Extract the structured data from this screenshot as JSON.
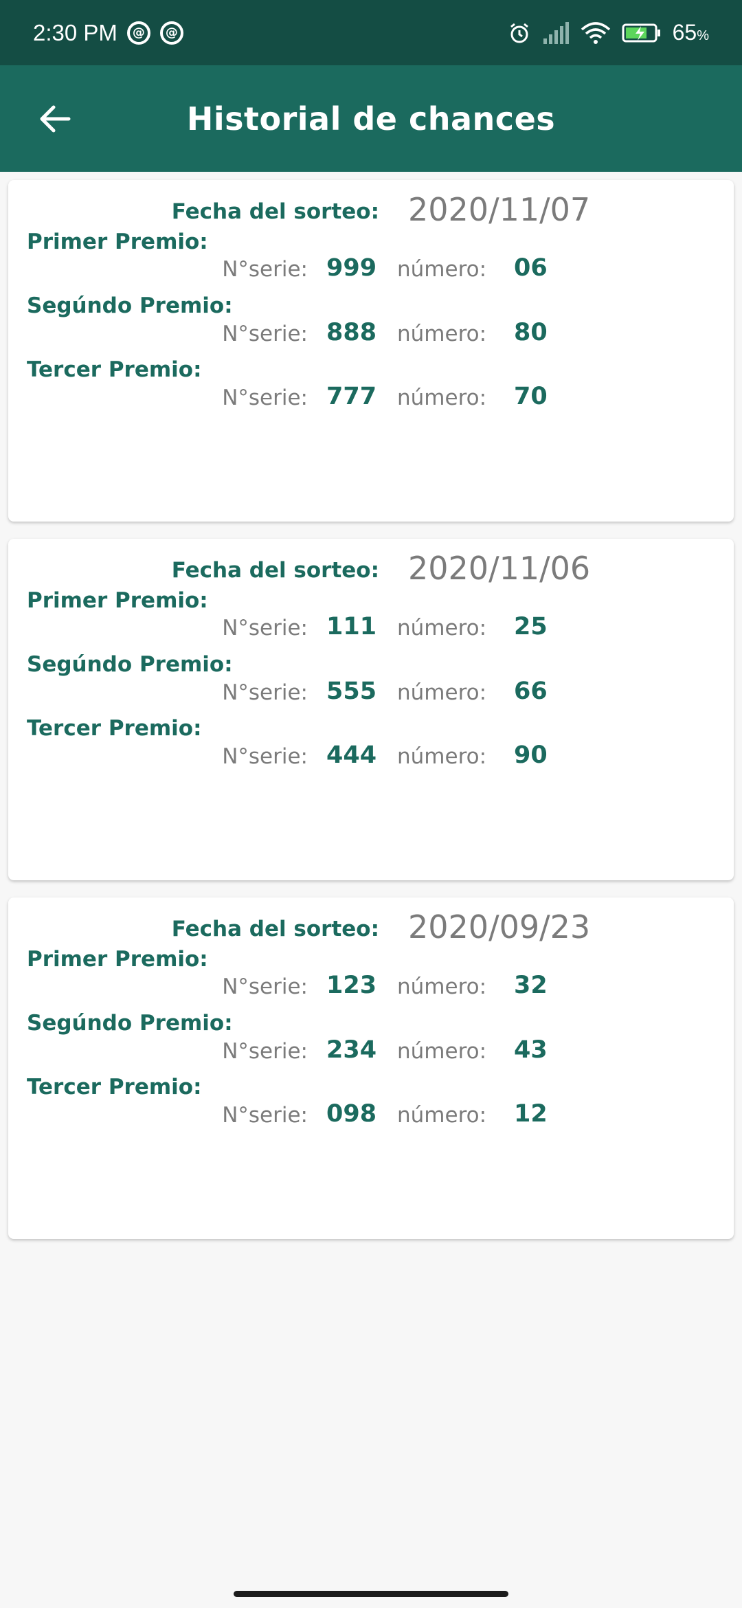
{
  "status_bar": {
    "time": "2:30 PM",
    "battery_percent": "65",
    "battery_unit": "%",
    "icons": [
      "notification-icon",
      "notification-icon",
      "alarm-icon",
      "signal-icon",
      "wifi-icon",
      "battery-charging-icon"
    ]
  },
  "app_bar": {
    "title": "Historial de chances",
    "back_icon": "arrow-back-icon"
  },
  "colors": {
    "status_bar": "#144d44",
    "app_bar": "#1b6a5e",
    "accent_text": "#1b6a5e",
    "muted_text": "#7b7b7b",
    "background": "#f7f7f7"
  },
  "labels": {
    "date": "Fecha del sorteo:",
    "serie": "N°serie:",
    "numero": "número:"
  },
  "draws": [
    {
      "date": "2020/11/07",
      "prizes": [
        {
          "title": "Primer Premio:",
          "serie": "999",
          "numero": "06"
        },
        {
          "title": "Segúndo Premio:",
          "serie": "888",
          "numero": "80"
        },
        {
          "title": "Tercer Premio:",
          "serie": "777",
          "numero": "70"
        }
      ]
    },
    {
      "date": "2020/11/06",
      "prizes": [
        {
          "title": "Primer Premio:",
          "serie": "111",
          "numero": "25"
        },
        {
          "title": "Segúndo Premio:",
          "serie": "555",
          "numero": "66"
        },
        {
          "title": "Tercer Premio:",
          "serie": "444",
          "numero": "90"
        }
      ]
    },
    {
      "date": "2020/09/23",
      "prizes": [
        {
          "title": "Primer Premio:",
          "serie": "123",
          "numero": "32"
        },
        {
          "title": "Segúndo Premio:",
          "serie": "234",
          "numero": "43"
        },
        {
          "title": "Tercer Premio:",
          "serie": "098",
          "numero": "12"
        }
      ]
    }
  ]
}
